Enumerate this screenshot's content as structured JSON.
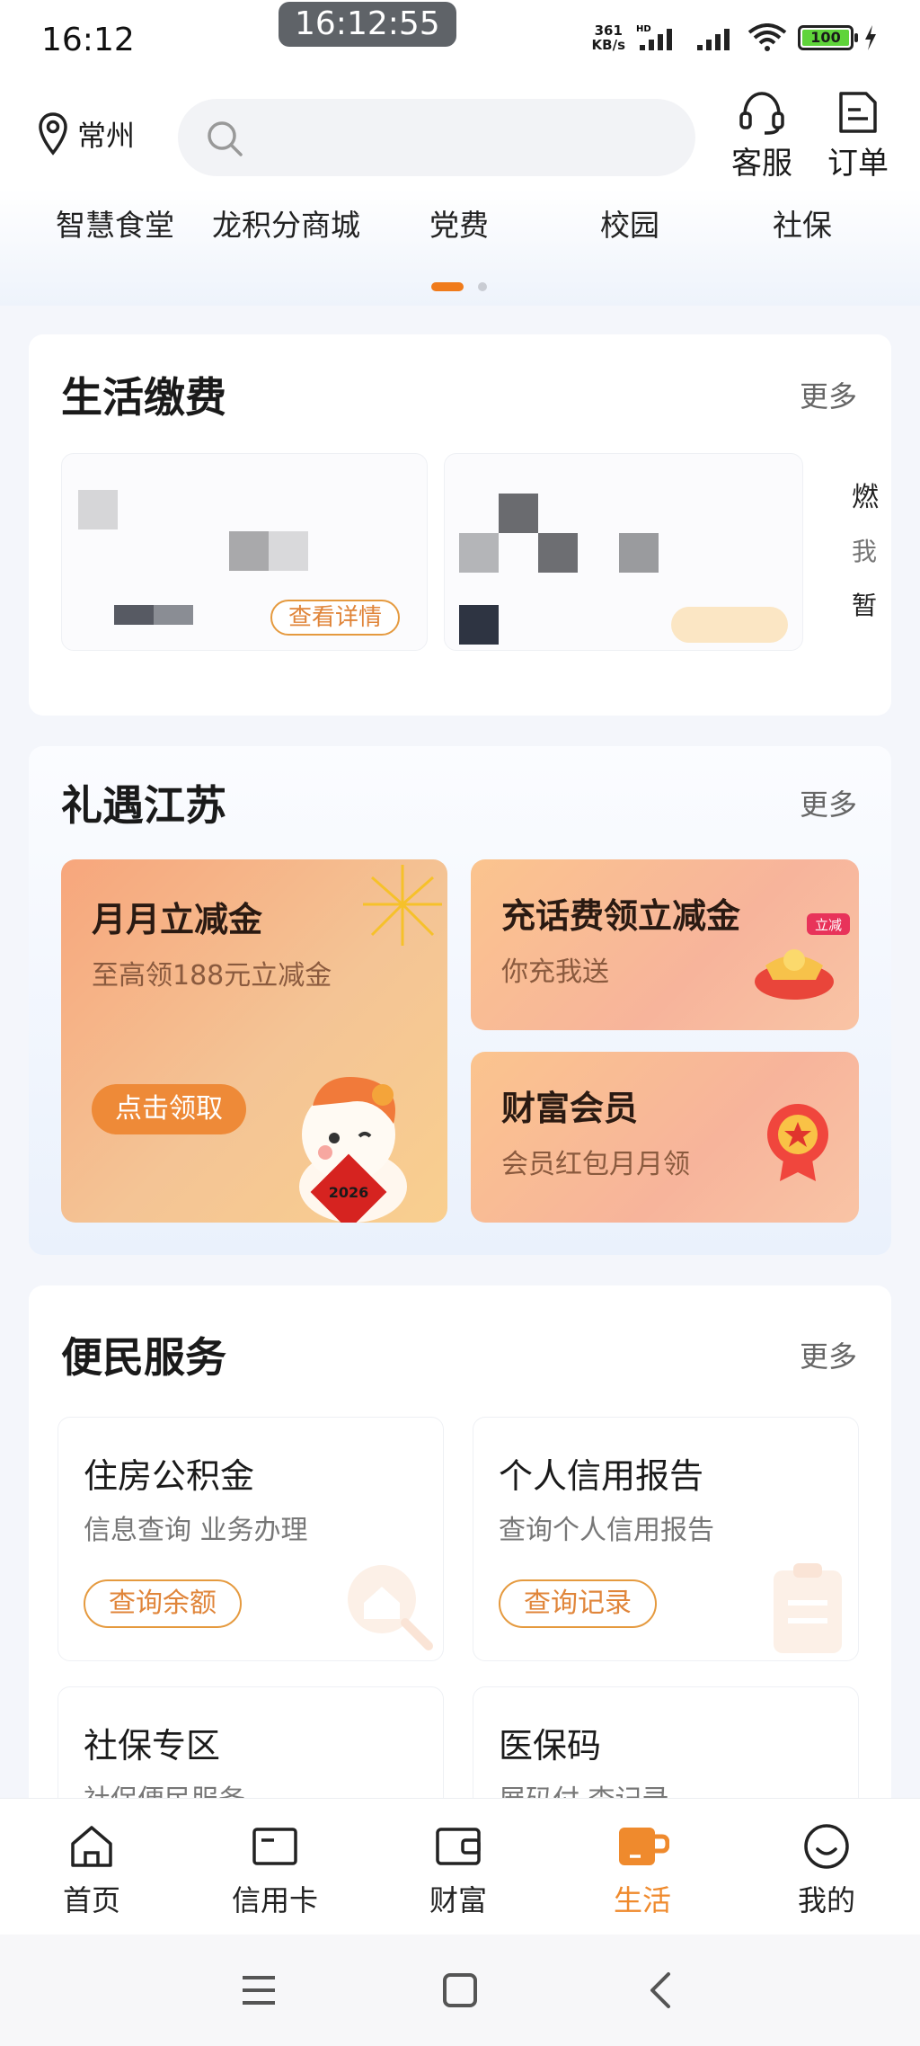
{
  "status_bar": {
    "time": "16:12",
    "clock_pill": "16:12:55",
    "net_speed_value": "361",
    "net_speed_unit": "KB/s",
    "hd": "HD",
    "battery": "100"
  },
  "header": {
    "location": "常州",
    "search_placeholder": "",
    "service_label": "客服",
    "orders_label": "订单"
  },
  "quick_nav": {
    "items": [
      "智慧食堂",
      "龙积分商城",
      "党费",
      "校园",
      "社保"
    ]
  },
  "life_payment": {
    "title": "生活缴费",
    "more": "更多",
    "tile1_button": "查看详情",
    "side_tile": [
      "燃",
      "我",
      "暂"
    ]
  },
  "promo": {
    "title": "礼遇江苏",
    "more": "更多",
    "big_card": {
      "title": "月月立减金",
      "subtitle": "至高领188元立减金",
      "cta": "点击领取",
      "badge_year": "2026"
    },
    "small_cards": [
      {
        "title": "充话费领立减金",
        "subtitle": "你充我送",
        "badge": "立减"
      },
      {
        "title": "财富会员",
        "subtitle": "会员红包月月领"
      }
    ]
  },
  "services": {
    "title": "便民服务",
    "more": "更多",
    "items": [
      {
        "title": "住房公积金",
        "subtitle": "信息查询 业务办理",
        "button": "查询余额"
      },
      {
        "title": "个人信用报告",
        "subtitle": "查询个人信用报告",
        "button": "查询记录"
      },
      {
        "title": "社保专区",
        "subtitle": "社保便民服务"
      },
      {
        "title": "医保码",
        "subtitle": "展码付 查记录"
      }
    ]
  },
  "tabbar": {
    "items": [
      "首页",
      "信用卡",
      "财富",
      "生活",
      "我的"
    ],
    "active": "生活",
    "active_color": "#ef8a2d"
  }
}
